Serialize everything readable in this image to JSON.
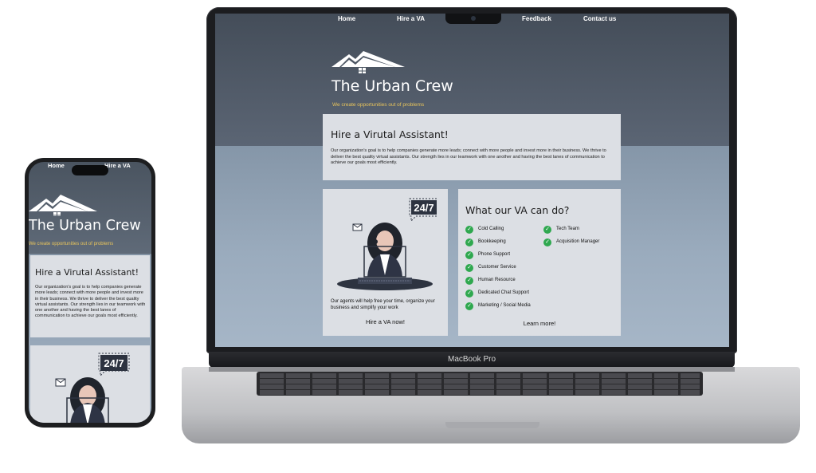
{
  "nav": {
    "home": "Home",
    "hire_va": "Hire a VA",
    "feedback": "Feedback",
    "contact": "Contact us"
  },
  "brand": {
    "name": "The Urban Crew",
    "tagline": "We create opportunities out of problems"
  },
  "hire_card": {
    "title": "Hire a Virutal Assistant!",
    "body": "Our organization's goal is to help companies generate more leads; connect with more people and invest more in their business. We thrive to deliver the best quality virtual assistants. Our strength lies in our teamwork with one another and having the best lanes of communication to achieve our goals most efficiently."
  },
  "agent_card": {
    "badge": "24/7",
    "text": "Our agents will help free your time, organize your business and simplify your work",
    "cta": "Hire a VA now!"
  },
  "services_card": {
    "title": "What our VA can do?",
    "left_items": [
      "Cold Calling",
      "Bookkeeping",
      "Phone Support",
      "Customer Service",
      "Human Resource",
      "Dedicated Chat Support",
      "Marketing / Social Media"
    ],
    "right_items": [
      "Tech Team",
      "Acquisition Manager"
    ],
    "cta": "Learn more!"
  },
  "device": {
    "laptop_label": "MacBook Pro"
  },
  "phone": {
    "nav": {
      "home": "Home",
      "hire_va": "Hire a VA"
    },
    "body_text": "Our organization's goal is to help companies generate more leads; connect with more people and invest more in their business. We thrive to deliver the best quality virtual assistants. Our strength lies in our teamwork with one another and having the best lanes of communication to achieve our goals most efficiently."
  },
  "colors": {
    "accent_tagline": "#e9c55c",
    "check_green": "#2fa84f",
    "hero_dark": "#4a5460",
    "card_bg": "#dcdfe4"
  }
}
